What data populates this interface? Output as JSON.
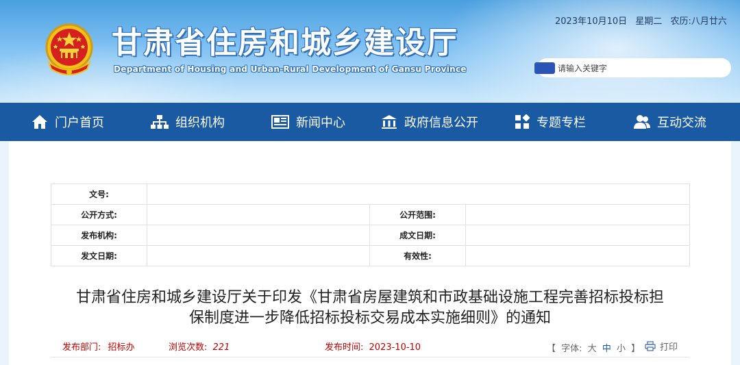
{
  "header": {
    "site_title": "甘肃省住房和城乡建设厅",
    "site_subtitle": "Department of Housing and Urban-Rural Development of Gansu Province",
    "date": "2023年10月10日",
    "weekday": "星期二",
    "lunar": "农历:八月廿六",
    "search_placeholder": "请输入关键字",
    "emblem": "national-emblem-icon"
  },
  "nav": [
    {
      "label": "门户首页",
      "icon": "home-icon"
    },
    {
      "label": "组织机构",
      "icon": "org-chart-icon"
    },
    {
      "label": "新闻中心",
      "icon": "newspaper-icon"
    },
    {
      "label": "政府信息公开",
      "icon": "government-building-icon"
    },
    {
      "label": "专题专栏",
      "icon": "grid-icon"
    },
    {
      "label": "互动交流",
      "icon": "users-icon"
    }
  ],
  "meta": {
    "wenhao_label": "文号:",
    "wenhao_value": "",
    "gongkai_fangshi_label": "公开方式:",
    "gongkai_fangshi_value": "",
    "gongkai_fanwei_label": "公开范围:",
    "gongkai_fanwei_value": "",
    "fabu_jigou_label": "发布机构:",
    "fabu_jigou_value": "",
    "chengwen_riqi_label": "成文日期:",
    "chengwen_riqi_value": "",
    "fawen_riqi_label": "发文日期:",
    "fawen_riqi_value": "",
    "youxiaoxing_label": "有效性:",
    "youxiaoxing_value": ""
  },
  "article": {
    "title_line1": "甘肃省住房和城乡建设厅关于印发《甘肃省房屋建筑和市政基础设施工程完善招标投标担",
    "title_line2": "保制度进一步降低招标投标交易成本实施细则》的通知",
    "dept_label": "发布部门:",
    "dept_value": "招标办",
    "views_label": "浏览次数:",
    "views_value": "221",
    "time_label": "发布时间:",
    "time_value": "2023-10-10",
    "font_open": "【",
    "font_label": "字体:",
    "font_large": "大",
    "font_medium": "中",
    "font_small": "小",
    "font_close": "】",
    "print_label": "打印"
  },
  "colors": {
    "nav_bg": "#1a5aa3",
    "accent_red": "#c40000",
    "header_sky": "#7ec0f2"
  }
}
